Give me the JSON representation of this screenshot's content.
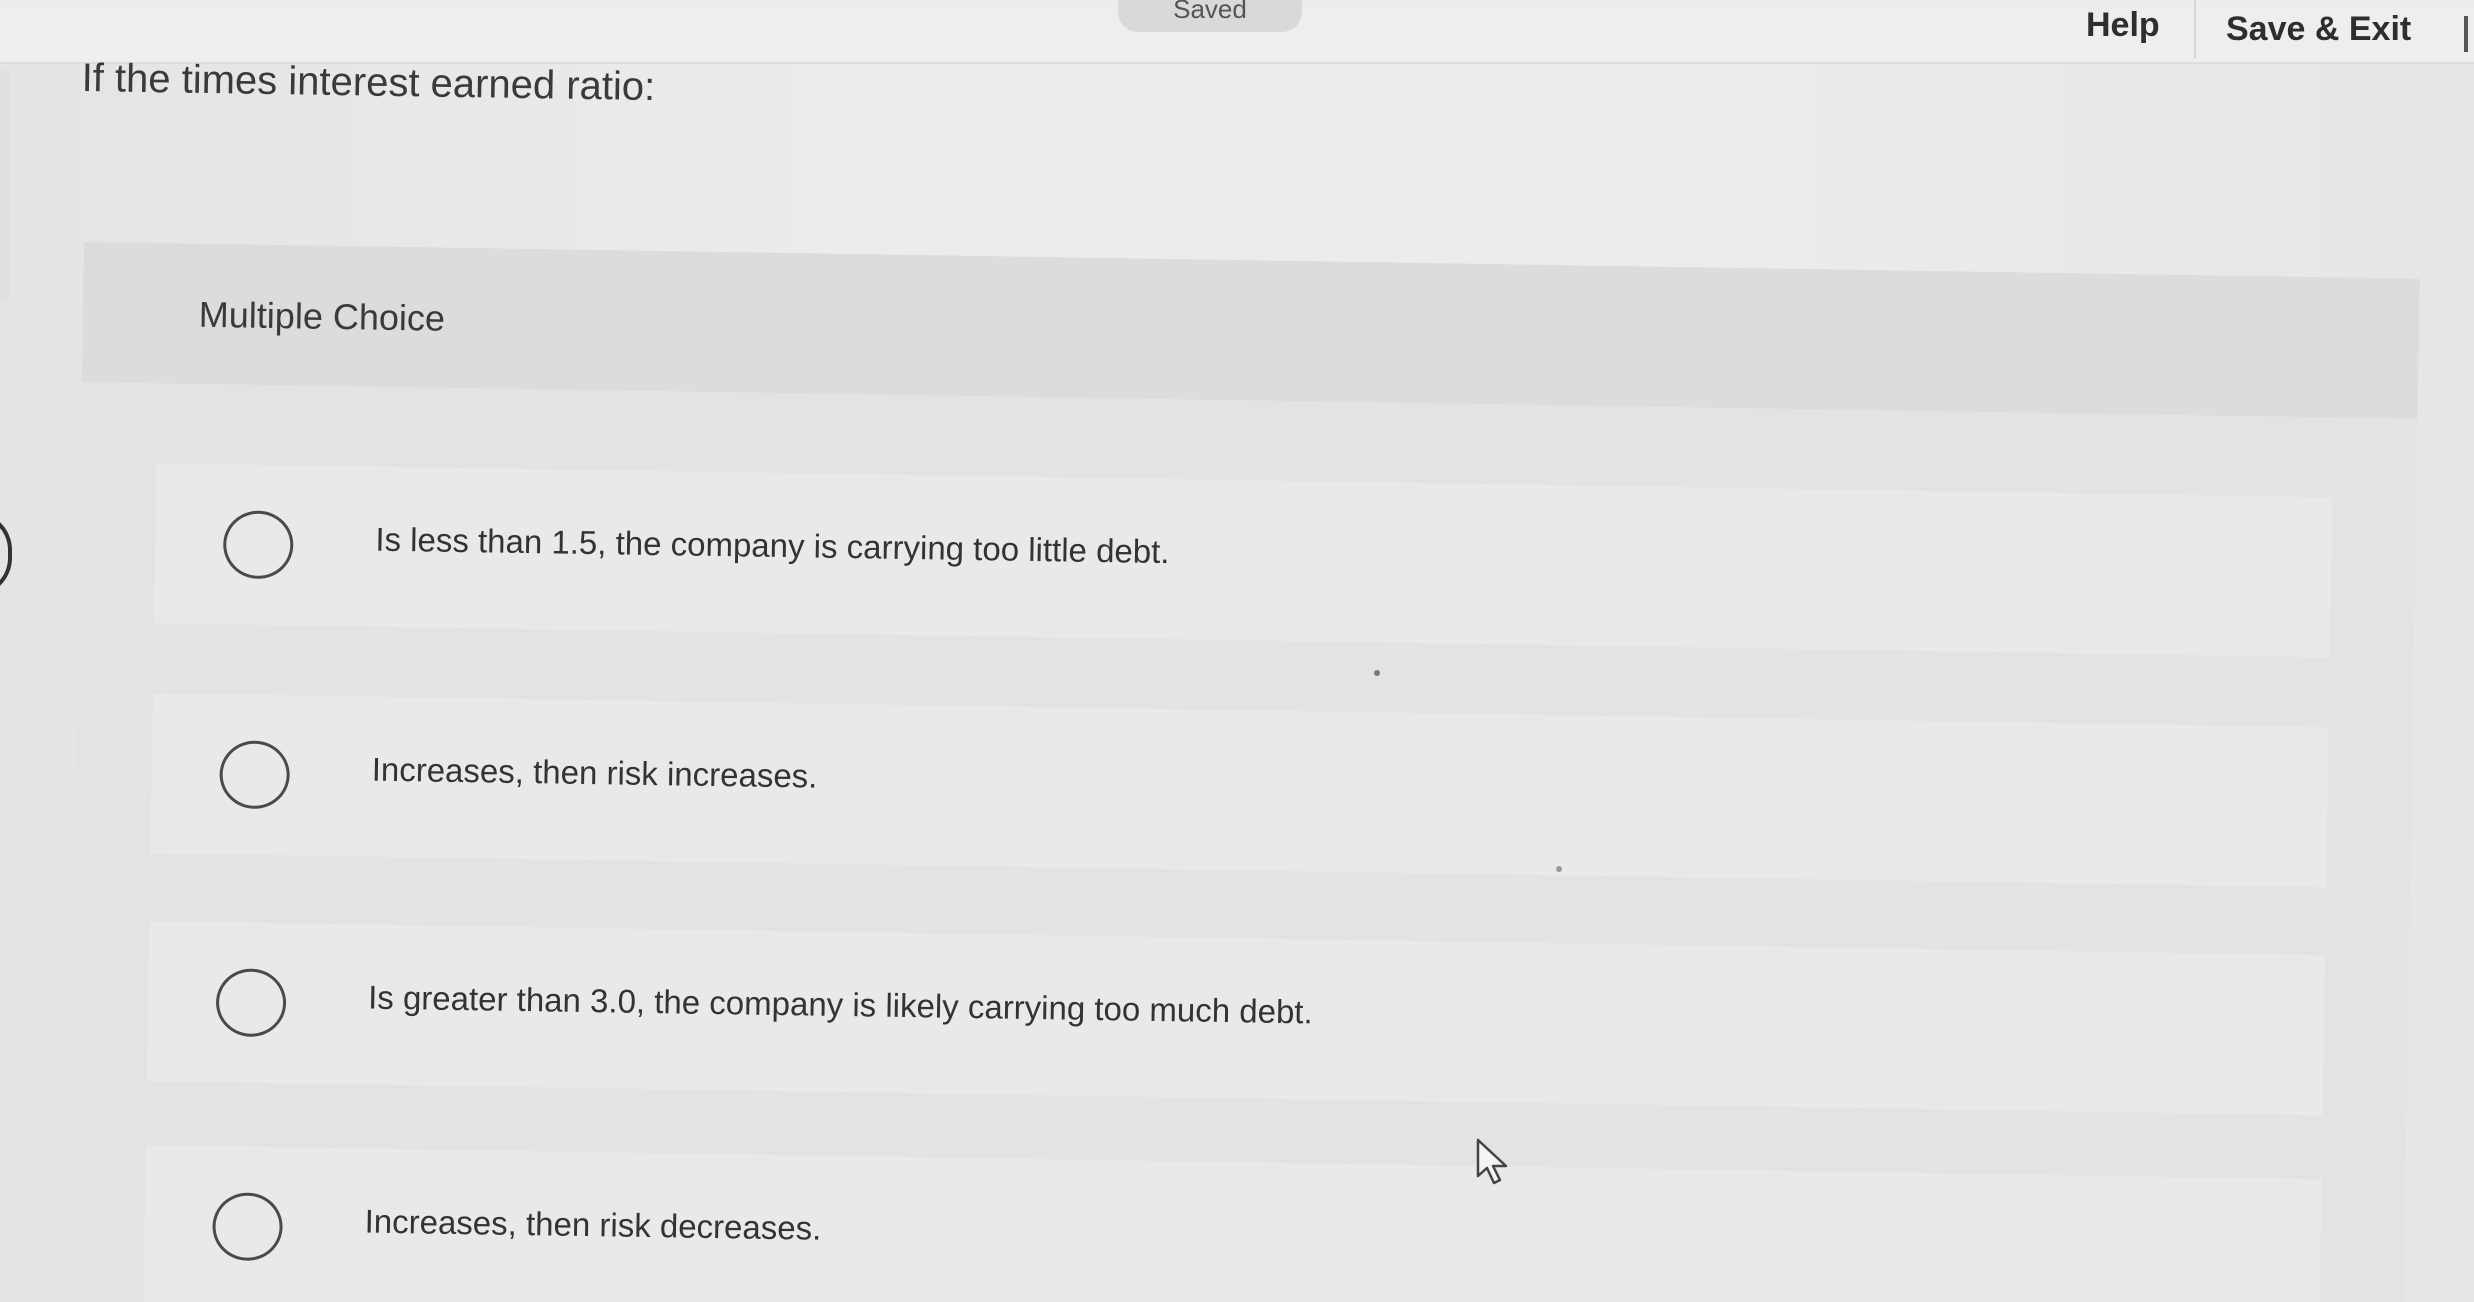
{
  "topbar": {
    "saved_label": "Saved",
    "help_label": "Help",
    "save_exit_label": "Save & Exit"
  },
  "question": {
    "prompt": "If the times interest earned ratio:"
  },
  "multiple_choice": {
    "title": "Multiple Choice",
    "options": [
      {
        "label": "Is less than 1.5, the company is carrying too little debt.",
        "selected": false
      },
      {
        "label": "Increases, then risk increases.",
        "selected": false
      },
      {
        "label": "Is greater than 3.0, the company is likely carrying too much debt.",
        "selected": false
      },
      {
        "label": "Increases, then risk decreases.",
        "selected": false
      }
    ]
  },
  "colors": {
    "background": "#ececec",
    "card": "#e3e3e3",
    "option_bg": "#e9e9e9",
    "text": "#333333"
  },
  "icons": {
    "radio": "radio-unchecked-icon",
    "cursor": "mouse-pointer-icon"
  }
}
